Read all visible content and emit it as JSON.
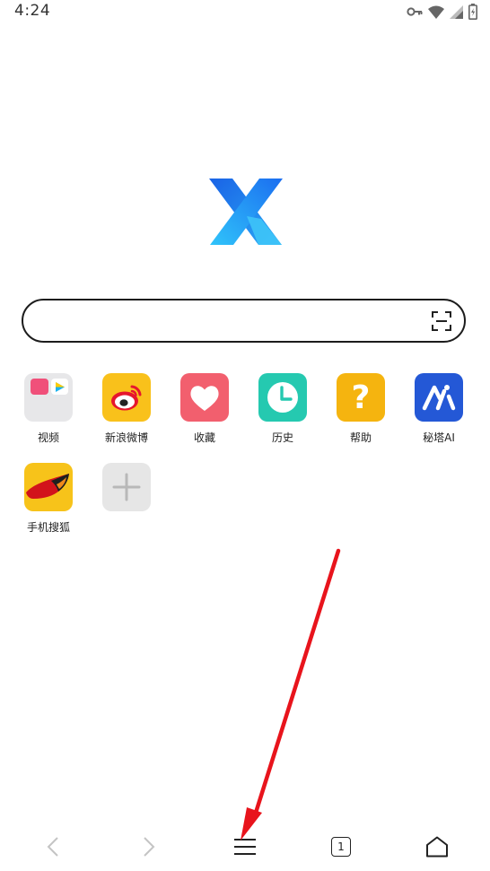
{
  "status_bar": {
    "time": "4:24",
    "icons": [
      "vpn-key-icon",
      "wifi-icon",
      "signal-icon",
      "battery-icon"
    ]
  },
  "logo": {
    "icon": "x-browser-logo",
    "colors": [
      "#1e7bf0",
      "#25b8f5"
    ]
  },
  "search": {
    "value": "",
    "placeholder": "",
    "scan_icon": "scan-icon"
  },
  "shortcuts": [
    {
      "label": "视频",
      "icon": "video-folder-icon"
    },
    {
      "label": "新浪微博",
      "icon": "weibo-icon",
      "color": "#f9c11b"
    },
    {
      "label": "收藏",
      "icon": "heart-icon",
      "color": "#f25f6e"
    },
    {
      "label": "历史",
      "icon": "clock-icon",
      "color": "#25c9b0"
    },
    {
      "label": "帮助",
      "icon": "help-icon",
      "color": "#f5b40f"
    },
    {
      "label": "秘塔AI",
      "icon": "metaso-icon",
      "color": "#2458d6"
    },
    {
      "label": "手机搜狐",
      "icon": "sohu-fox-icon",
      "color": "#f7c31a"
    },
    {
      "label": "",
      "icon": "add-icon",
      "color": "#e6e6e6"
    }
  ],
  "bottom_nav": {
    "items": [
      "back-icon",
      "forward-icon",
      "menu-icon",
      "tabs-icon",
      "home-icon"
    ],
    "tab_count": "1"
  },
  "annotation": {
    "color": "#e8141c",
    "points_to": "menu-icon"
  }
}
